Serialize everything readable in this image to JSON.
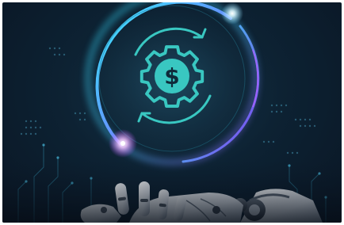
{
  "image": {
    "subject": "robot-hand-holding-money-gear-hologram",
    "icon_names": [
      "dollar-sign-icon",
      "gear-icon",
      "refresh-arrows-icon",
      "robot-hand"
    ],
    "colors": {
      "background": "#0c1b2a",
      "ring_cyan": "#2ee6ff",
      "ring_purple": "#a347ff",
      "icon_teal": "#38c6c0",
      "robot_white": "#e8eaf0"
    }
  }
}
